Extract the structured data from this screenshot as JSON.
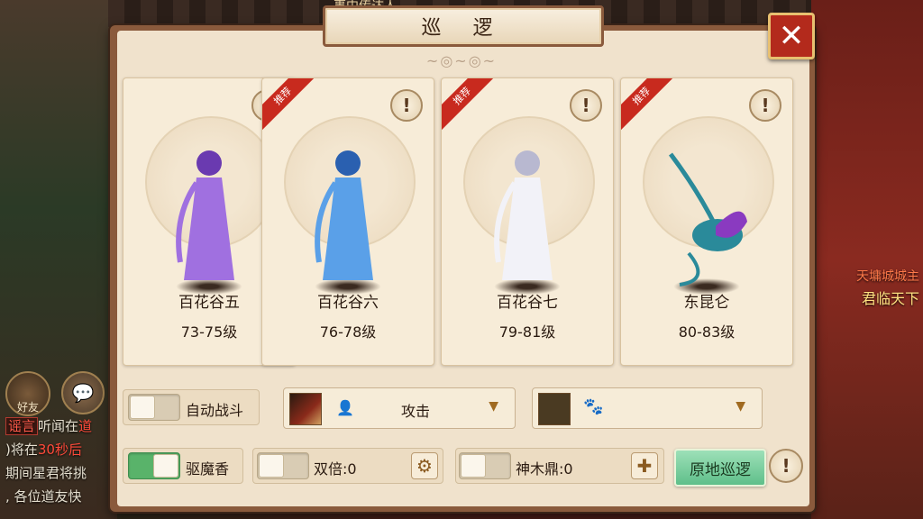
{
  "window": {
    "title": "巡 逻",
    "close_icon": "✕"
  },
  "cards": [
    {
      "name": "百花谷五",
      "level": "73-75级",
      "recommended": false,
      "sprite_color": "#a070e0",
      "sprite_dark": "#6a3ab0"
    },
    {
      "name": "百花谷六",
      "level": "76-78级",
      "recommended": true,
      "sprite_color": "#5aa0e8",
      "sprite_dark": "#2a60b0"
    },
    {
      "name": "百花谷七",
      "level": "79-81级",
      "recommended": true,
      "sprite_color": "#f2f2f8",
      "sprite_dark": "#b8b8d0"
    },
    {
      "name": "东昆仑",
      "level": "80-83级",
      "recommended": true,
      "sprite_color": "#8a3ac0",
      "sprite_dark": "#2a8a9a"
    }
  ],
  "recommend_label": "推荐",
  "info_glyph": "!",
  "controls": {
    "auto_battle_label": "自动战斗",
    "auto_battle_on": false,
    "attack_label": "攻击",
    "pet_dropdown_value": "",
    "repel_label": "驱魔香",
    "repel_on": true,
    "double_label": "双倍:0",
    "double_on": false,
    "shenmu_label": "神木鼎:0",
    "shenmu_on": false,
    "patrol_button": "原地巡逻"
  },
  "background": {
    "chat": [
      {
        "tag": "谣言",
        "text": "听闻在",
        "red": "道"
      },
      {
        "tag": "",
        "text": ")将在",
        "red": "30秒后"
      },
      {
        "tag": "",
        "text": "期间星君将挑",
        "red": ""
      },
      {
        "tag": "",
        "text": ", 各位道友快",
        "red": ""
      }
    ],
    "friend_label": "好友",
    "top_label": "事中传达人",
    "npc_title": "天墉城城主",
    "npc_name": "君临天下"
  }
}
